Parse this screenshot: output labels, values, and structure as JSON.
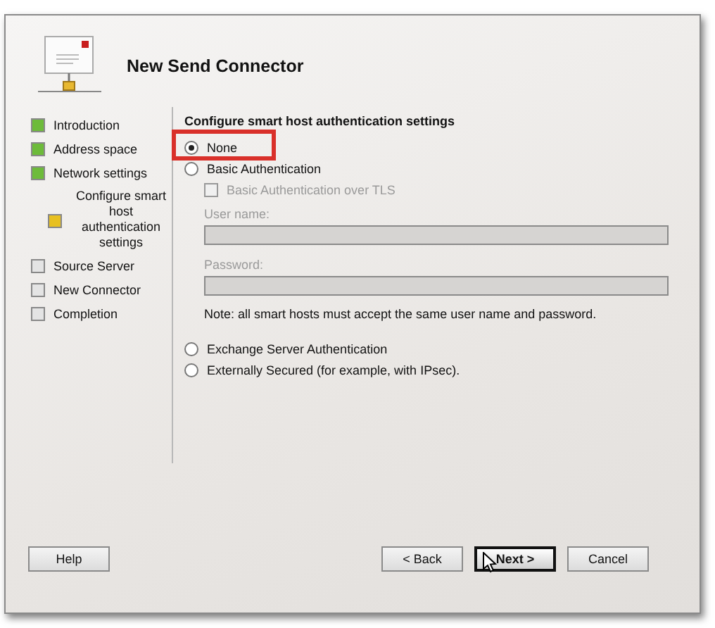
{
  "window": {
    "title": "New Send Connector"
  },
  "steps": [
    {
      "label": "Introduction",
      "color": "#6dbb3a"
    },
    {
      "label": "Address space",
      "color": "#6dbb3a"
    },
    {
      "label": "Network settings",
      "color": "#6dbb3a",
      "children": [
        {
          "label": "Configure smart host authentication settings",
          "color": "#e8c020"
        }
      ]
    },
    {
      "label": "Source Server",
      "color": "#e4e4e4"
    },
    {
      "label": "New Connector",
      "color": "#e4e4e4"
    },
    {
      "label": "Completion",
      "color": "#e4e4e4"
    }
  ],
  "page": {
    "heading": "Configure smart host authentication settings",
    "options": [
      {
        "kind": "radio",
        "label": "None",
        "selected": true,
        "highlighted": true
      },
      {
        "kind": "radio",
        "label": "Basic Authentication",
        "selected": false,
        "highlighted": false
      },
      {
        "kind": "checkbox",
        "label": "Basic Authentication over TLS",
        "checked": false,
        "disabled": true
      },
      {
        "kind": "field",
        "label": "User name:",
        "disabled": true
      },
      {
        "kind": "field",
        "label": "Password:",
        "disabled": true
      },
      {
        "kind": "note",
        "label": "Note: all smart hosts must accept the same user name and password."
      },
      {
        "kind": "radio",
        "label": "Exchange Server Authentication",
        "selected": false,
        "highlighted": false
      },
      {
        "kind": "radio",
        "label": "Externally Secured (for example, with IPsec).",
        "selected": false,
        "highlighted": false
      }
    ]
  },
  "buttons": [
    {
      "label": "Help",
      "kind": "help"
    },
    {
      "label": "< Back",
      "kind": "nav",
      "default": false
    },
    {
      "label": "Next >",
      "kind": "nav",
      "default": true
    },
    {
      "label": "Cancel",
      "kind": "nav",
      "default": false
    }
  ]
}
